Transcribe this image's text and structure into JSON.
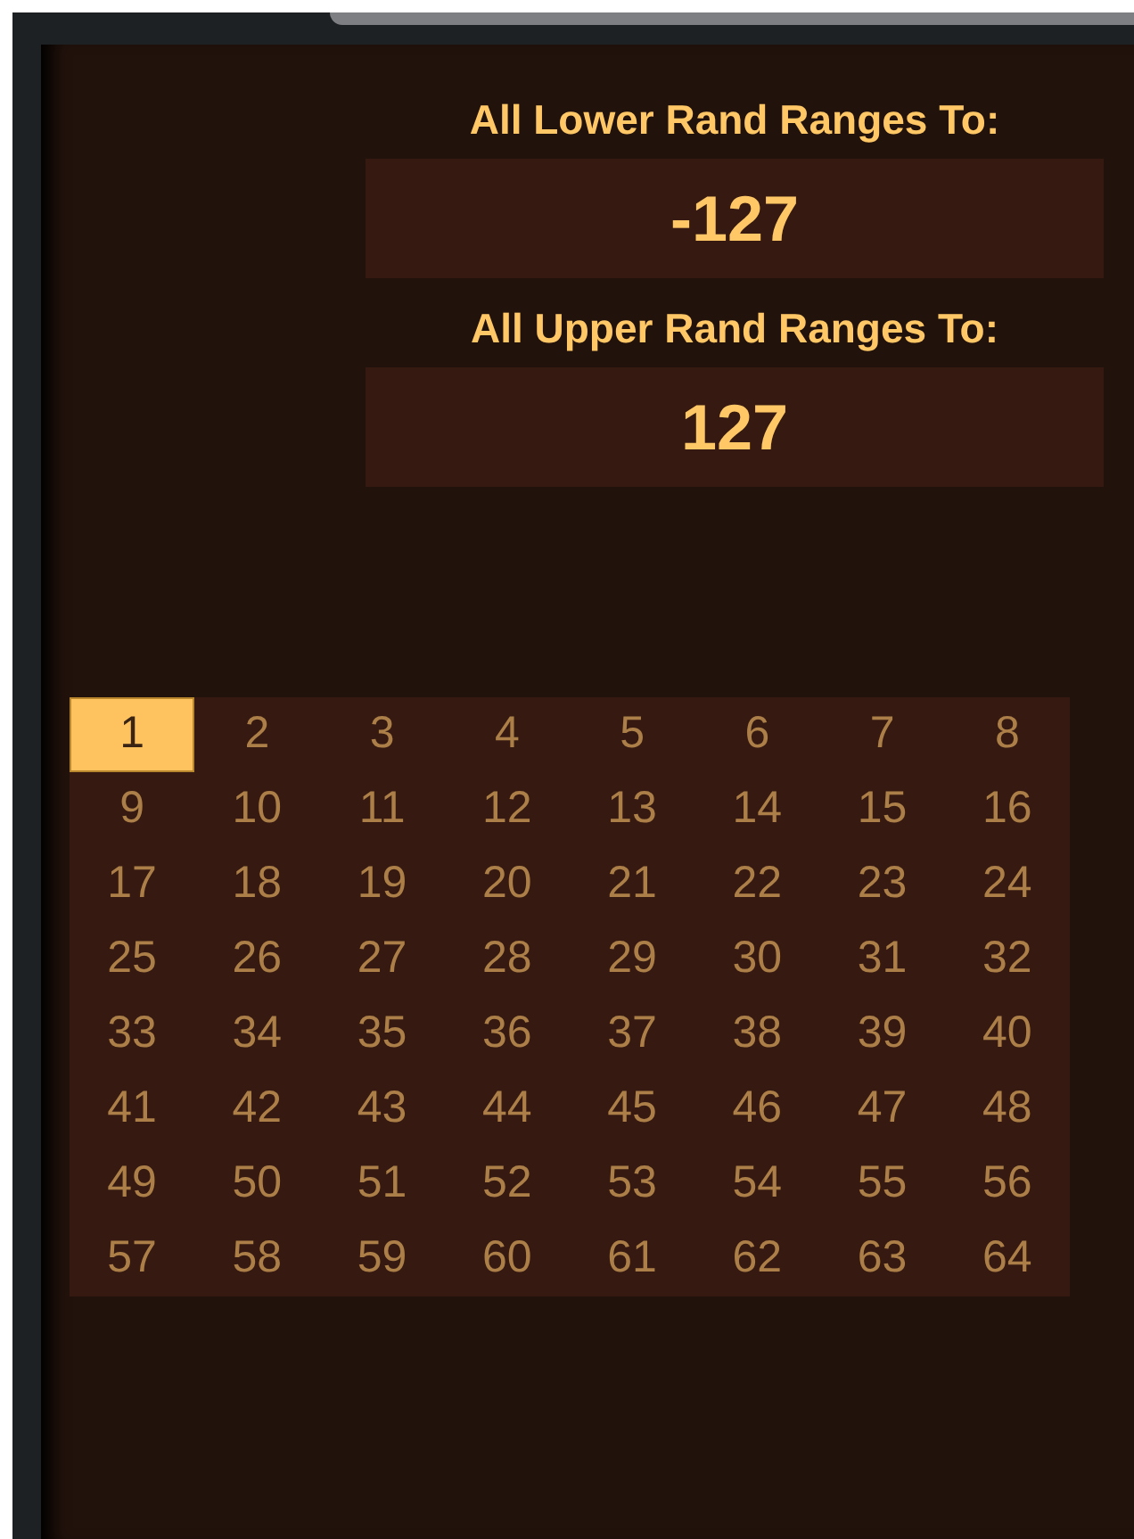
{
  "range_fields": [
    {
      "label": "All Lower Rand Ranges To:",
      "value": "-127"
    },
    {
      "label": "All Upper Rand Ranges To:",
      "value": "127"
    }
  ],
  "grid": {
    "cells": [
      {
        "label": "1",
        "selected": true
      },
      {
        "label": "2",
        "selected": false
      },
      {
        "label": "3",
        "selected": false
      },
      {
        "label": "4",
        "selected": false
      },
      {
        "label": "5",
        "selected": false
      },
      {
        "label": "6",
        "selected": false
      },
      {
        "label": "7",
        "selected": false
      },
      {
        "label": "8",
        "selected": false
      },
      {
        "label": "9",
        "selected": false
      },
      {
        "label": "10",
        "selected": false
      },
      {
        "label": "11",
        "selected": false
      },
      {
        "label": "12",
        "selected": false
      },
      {
        "label": "13",
        "selected": false
      },
      {
        "label": "14",
        "selected": false
      },
      {
        "label": "15",
        "selected": false
      },
      {
        "label": "16",
        "selected": false
      },
      {
        "label": "17",
        "selected": false
      },
      {
        "label": "18",
        "selected": false
      },
      {
        "label": "19",
        "selected": false
      },
      {
        "label": "20",
        "selected": false
      },
      {
        "label": "21",
        "selected": false
      },
      {
        "label": "22",
        "selected": false
      },
      {
        "label": "23",
        "selected": false
      },
      {
        "label": "24",
        "selected": false
      },
      {
        "label": "25",
        "selected": false
      },
      {
        "label": "26",
        "selected": false
      },
      {
        "label": "27",
        "selected": false
      },
      {
        "label": "28",
        "selected": false
      },
      {
        "label": "29",
        "selected": false
      },
      {
        "label": "30",
        "selected": false
      },
      {
        "label": "31",
        "selected": false
      },
      {
        "label": "32",
        "selected": false
      },
      {
        "label": "33",
        "selected": false
      },
      {
        "label": "34",
        "selected": false
      },
      {
        "label": "35",
        "selected": false
      },
      {
        "label": "36",
        "selected": false
      },
      {
        "label": "37",
        "selected": false
      },
      {
        "label": "38",
        "selected": false
      },
      {
        "label": "39",
        "selected": false
      },
      {
        "label": "40",
        "selected": false
      },
      {
        "label": "41",
        "selected": false
      },
      {
        "label": "42",
        "selected": false
      },
      {
        "label": "43",
        "selected": false
      },
      {
        "label": "44",
        "selected": false
      },
      {
        "label": "45",
        "selected": false
      },
      {
        "label": "46",
        "selected": false
      },
      {
        "label": "47",
        "selected": false
      },
      {
        "label": "48",
        "selected": false
      },
      {
        "label": "49",
        "selected": false
      },
      {
        "label": "50",
        "selected": false
      },
      {
        "label": "51",
        "selected": false
      },
      {
        "label": "52",
        "selected": false
      },
      {
        "label": "53",
        "selected": false
      },
      {
        "label": "54",
        "selected": false
      },
      {
        "label": "55",
        "selected": false
      },
      {
        "label": "56",
        "selected": false
      },
      {
        "label": "57",
        "selected": false
      },
      {
        "label": "58",
        "selected": false
      },
      {
        "label": "59",
        "selected": false
      },
      {
        "label": "60",
        "selected": false
      },
      {
        "label": "61",
        "selected": false
      },
      {
        "label": "62",
        "selected": false
      },
      {
        "label": "63",
        "selected": false
      },
      {
        "label": "64",
        "selected": false
      }
    ]
  }
}
